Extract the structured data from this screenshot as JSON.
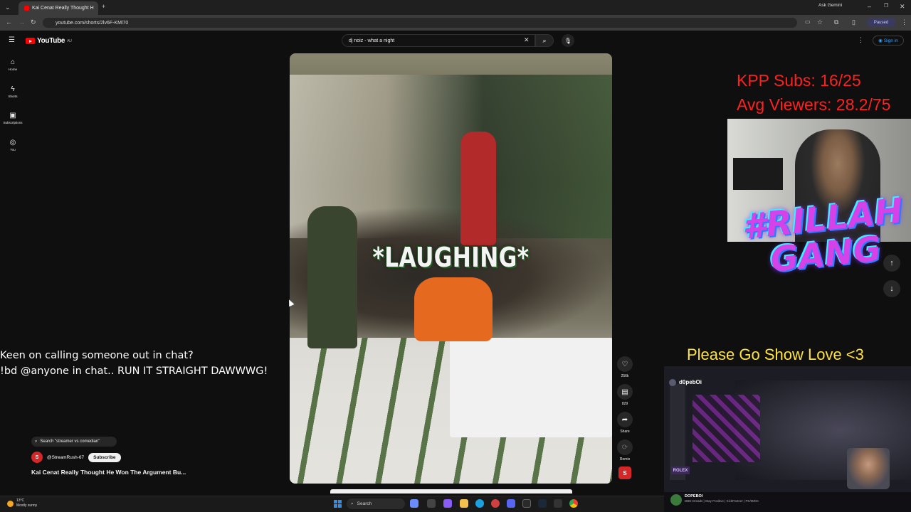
{
  "browser": {
    "tab_title": "Kai Cenat Really Thought H",
    "url": "youtube.com/shorts/2lv6F-KMl70",
    "ask_gemini": "Ask Gemini",
    "paused": "Paused"
  },
  "youtube": {
    "logo_text": "YouTube",
    "region": "AU",
    "search_value": "dj noiz - what a night",
    "sign_in": "Sign in",
    "nav": [
      {
        "label": "Home",
        "icon": "home-icon"
      },
      {
        "label": "Shorts",
        "icon": "shorts-icon"
      },
      {
        "label": "Subscriptions",
        "icon": "subscriptions-icon"
      },
      {
        "label": "You",
        "icon": "you-icon"
      }
    ]
  },
  "video": {
    "caption": "*LAUGHING*",
    "actions": {
      "likes": "256k",
      "comments": "829",
      "share": "Share",
      "remix": "Remix"
    },
    "search_pill": "Search \"streamer vs comedian\"",
    "channel": "@StreamRush-67",
    "subscribe": "Subscribe",
    "title": "Kai Cenat Really Thought He Won The Argument Bu..."
  },
  "overlay": {
    "kpp_subs": "KPP Subs: 16/25",
    "avg_viewers": "Avg Viewers: 28.2/75",
    "gang": "#RILLAH GANG",
    "show_love": "Please Go Show Love <3",
    "callout_line1": "Keen on calling someone out in chat?",
    "callout_line2": "!bd @anyone in chat.. RUN IT STRAIGHT DAWWWG!",
    "stream_name": "d0pebOi",
    "stream_bar_name": "DOPEBOI",
    "stream_bar_sub": "DBD Dreads | Stay Positive | KickPartner | PK/M/DC",
    "rolex": "ROLEX"
  },
  "taskbar": {
    "temp": "13°C",
    "weather": "Mostly sunny",
    "search": "Search"
  },
  "colors": {
    "youtube_red": "#ff0000",
    "overlay_red": "#ff2020",
    "overlay_yellow": "#ffe33c",
    "link_blue": "#3ea6ff"
  }
}
